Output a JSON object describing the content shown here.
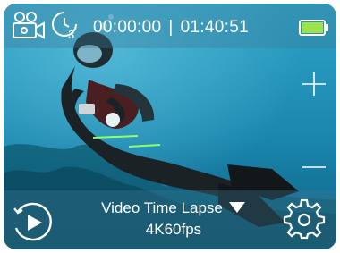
{
  "status": {
    "elapsed_time": "00:00:00",
    "separator": "|",
    "remaining_time": "01:40:51",
    "timer_value": "3",
    "battery_color": "#9be24b"
  },
  "controls": {
    "mode_name": "Video Time Lapse",
    "mode_resolution": "4K60fps"
  },
  "icons": {
    "record_mode": "video-camera-icon",
    "timer": "timer-icon",
    "battery": "battery-icon",
    "zoom_in": "plus-icon",
    "zoom_out": "minus-icon",
    "playback": "play-icon",
    "dropdown": "caret-down-icon",
    "settings": "gear-icon"
  },
  "colors": {
    "overlay_text": "#ffffff",
    "water": "#1d8fb5"
  }
}
